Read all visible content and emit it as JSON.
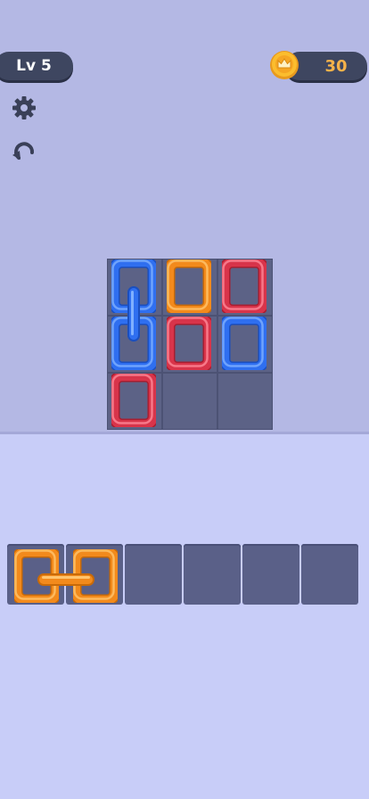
{
  "hud": {
    "level_label": "Lv 5",
    "coins": "30"
  },
  "icons": {
    "settings": "gear-icon",
    "undo": "undo-icon",
    "coin": "crown-coin-icon"
  },
  "colors": {
    "blue": "#2f6ff0",
    "orange": "#f28a1c",
    "red": "#d8344a"
  },
  "board": {
    "rows": 3,
    "cols": 3,
    "links": [
      {
        "row": 0,
        "col": 0,
        "color": "blue",
        "chained_to": "row1-col0"
      },
      {
        "row": 0,
        "col": 1,
        "color": "orange"
      },
      {
        "row": 0,
        "col": 2,
        "color": "red"
      },
      {
        "row": 1,
        "col": 0,
        "color": "blue",
        "chained_to": "row0-col0"
      },
      {
        "row": 1,
        "col": 1,
        "color": "red"
      },
      {
        "row": 1,
        "col": 2,
        "color": "blue"
      },
      {
        "row": 2,
        "col": 0,
        "color": "red"
      },
      {
        "row": 2,
        "col": 1,
        "color": "empty"
      },
      {
        "row": 2,
        "col": 2,
        "color": "empty"
      }
    ]
  },
  "tray": {
    "slot_count": 6,
    "filled": [
      {
        "slot": 0,
        "color": "orange",
        "chained_to": "slot1"
      },
      {
        "slot": 1,
        "color": "orange",
        "chained_to": "slot0"
      }
    ]
  }
}
